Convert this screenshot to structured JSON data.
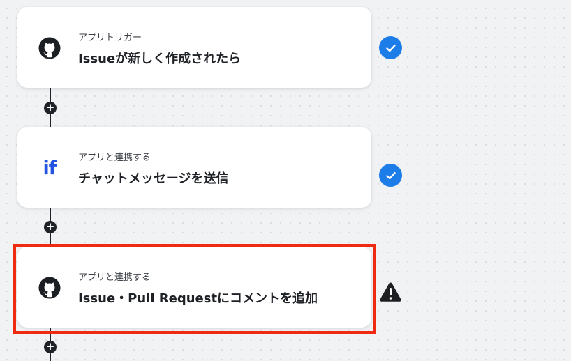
{
  "flow": {
    "steps": [
      {
        "app_icon": "github-icon",
        "subtitle": "アプリトリガー",
        "title": "Issueが新しく作成されたら",
        "status_icon": "check-circle-icon"
      },
      {
        "app_icon": "if-logo-icon",
        "app_logo_text": "if",
        "subtitle": "アプリと連携する",
        "title": "チャットメッセージを送信",
        "status_icon": "check-circle-icon"
      },
      {
        "app_icon": "github-icon",
        "subtitle": "アプリと連携する",
        "title": "Issue・Pull Requestにコメントを追加",
        "status_icon": "warning-icon",
        "highlighted": true
      }
    ],
    "add_step_symbol": "+"
  },
  "colors": {
    "check": "#1c7ce8",
    "warning": "#1e1f22",
    "highlight": "#f02a10",
    "connector": "#1f2329",
    "logo_blue": "#2152e0"
  }
}
